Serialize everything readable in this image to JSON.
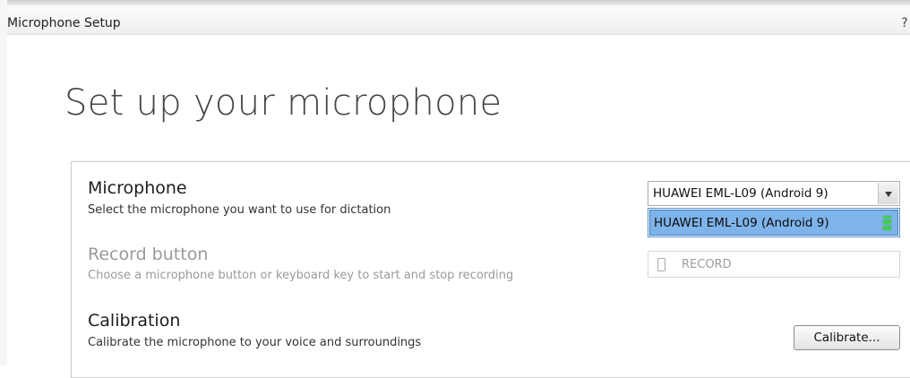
{
  "window": {
    "title": "Microphone Setup",
    "help": "?"
  },
  "heading": "Set up your microphone",
  "microphone": {
    "title": "Microphone",
    "description": "Select the microphone you want to use for dictation",
    "selected": "HUAWEI EML-L09 (Android 9)",
    "options": [
      "HUAWEI EML-L09 (Android 9)"
    ],
    "level_icon": "level-meter-icon"
  },
  "record_button": {
    "title": "Record button",
    "description": "Choose a microphone button or keyboard key to start and stop recording",
    "value": "RECORD",
    "icon": "phone-icon"
  },
  "calibration": {
    "title": "Calibration",
    "description": "Calibrate the microphone to your voice and surroundings",
    "button_label": "Calibrate..."
  },
  "colors": {
    "dropdown_highlight": "#7eb4ea",
    "level_meter": "#3fd23f"
  }
}
